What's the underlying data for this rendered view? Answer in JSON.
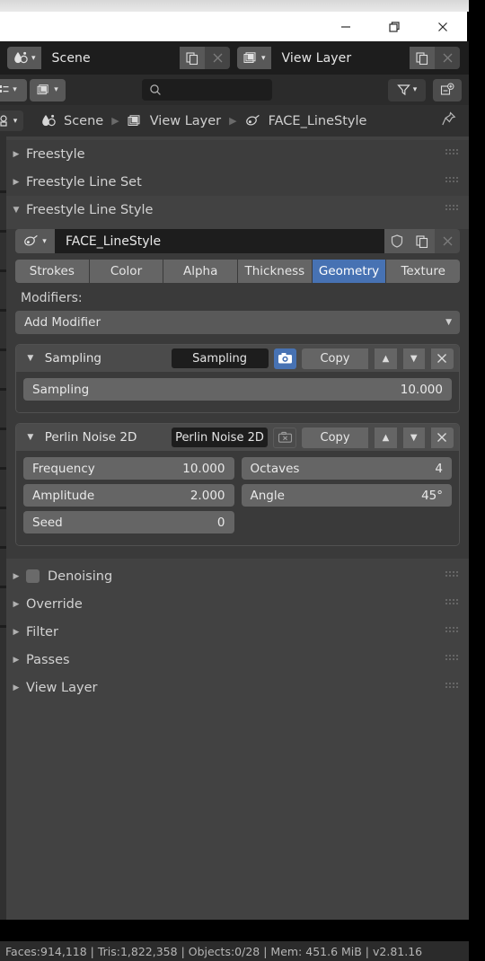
{
  "window": {
    "minimize_label": "minimize",
    "restore_label": "restore",
    "close_label": "close"
  },
  "topbar": {
    "scene": {
      "icon": "scene-icon",
      "value": "Scene",
      "new_label": "new-scene",
      "unlink_label": "unlink-scene"
    },
    "view_layer": {
      "icon": "view-layer-icon",
      "value": "View Layer",
      "new_label": "new-view-layer",
      "unlink_label": "unlink-view-layer"
    }
  },
  "toolrow": {
    "editor_type": "editor-type",
    "context_icon": "view-layer-icon",
    "search_placeholder": "",
    "search_value": "",
    "filter_label": "filter",
    "add_label": "new-collection"
  },
  "breadcrumb": {
    "items": [
      {
        "icon": "scene-icon",
        "label": "Scene"
      },
      {
        "icon": "view-layer-icon",
        "label": "View Layer"
      },
      {
        "icon": "linestyle-icon",
        "label": "FACE_LineStyle"
      }
    ],
    "pin_label": "pin-id-data"
  },
  "panels": [
    {
      "label": "Freestyle",
      "open": false,
      "checkbox": false
    },
    {
      "label": "Freestyle Line Set",
      "open": false,
      "checkbox": false
    },
    {
      "label": "Freestyle Line Style",
      "open": true,
      "checkbox": false
    }
  ],
  "linestyle": {
    "icon": "linestyle-icon",
    "name": "FACE_LineStyle",
    "shield_label": "fake-user",
    "copy_label": "new-linestyle",
    "unlink_label": "unlink-linestyle",
    "tabs": [
      {
        "label": "Strokes",
        "active": false
      },
      {
        "label": "Color",
        "active": false
      },
      {
        "label": "Alpha",
        "active": false
      },
      {
        "label": "Thickness",
        "active": false
      },
      {
        "label": "Geometry",
        "active": true
      },
      {
        "label": "Texture",
        "active": false
      }
    ],
    "modifiers_label": "Modifiers:",
    "add_modifier_label": "Add Modifier"
  },
  "modifiers": [
    {
      "type": "Sampling",
      "name": "Sampling",
      "camera_enabled": true,
      "copy_label": "Copy",
      "move_up_label": "move-up",
      "move_down_label": "move-down",
      "delete_label": "delete",
      "rows": [
        [
          {
            "key": "Sampling",
            "value": "10.000"
          }
        ]
      ]
    },
    {
      "type": "Perlin Noise 2D",
      "name": "Perlin Noise 2D",
      "camera_enabled": false,
      "copy_label": "Copy",
      "move_up_label": "move-up",
      "move_down_label": "move-down",
      "delete_label": "delete",
      "rows": [
        [
          {
            "key": "Frequency",
            "value": "10.000"
          },
          {
            "key": "Octaves",
            "value": "4"
          }
        ],
        [
          {
            "key": "Amplitude",
            "value": "2.000"
          },
          {
            "key": "Angle",
            "value": "45°"
          }
        ],
        [
          {
            "key": "Seed",
            "value": "0"
          },
          {
            "key": "",
            "value": ""
          }
        ]
      ]
    }
  ],
  "bottom_panels": [
    {
      "label": "Denoising",
      "open": false,
      "checkbox": true
    },
    {
      "label": "Override",
      "open": false,
      "checkbox": false
    },
    {
      "label": "Filter",
      "open": false,
      "checkbox": false
    },
    {
      "label": "Passes",
      "open": false,
      "checkbox": false
    },
    {
      "label": "View Layer",
      "open": false,
      "checkbox": false
    }
  ],
  "statusbar": {
    "text": "Faces:914,118 | Tris:1,822,358 | Objects:0/28 | Mem: 451.6 MiB | v2.81.16"
  },
  "colors": {
    "accent_blue": "#4772b3",
    "panel_bg": "#424242",
    "section_bg": "#3a3a3a",
    "field_bg": "#656565",
    "text": "#e2e2e2"
  }
}
